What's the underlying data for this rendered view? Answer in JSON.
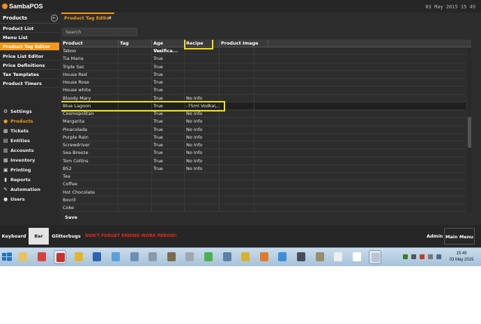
{
  "app": {
    "name": "SambaPOS",
    "clock": "03 May 2015 15 49"
  },
  "sidebar": {
    "header": "Products",
    "back_icon": "arrow-left-icon",
    "sub_items": [
      {
        "label": "Product List",
        "active": false
      },
      {
        "label": "Menu List",
        "active": false
      },
      {
        "label": "Product Tag Editor",
        "active": true
      },
      {
        "label": "Price List Editor",
        "active": false
      },
      {
        "label": "Price Definitions",
        "active": false
      },
      {
        "label": "Tax Templates",
        "active": false
      },
      {
        "label": "Product Timers",
        "active": false
      }
    ],
    "nav_items": [
      {
        "label": "Settings",
        "icon": "gear-icon",
        "glyph": "⚙",
        "active": false
      },
      {
        "label": "Products",
        "icon": "flame-icon",
        "glyph": "●",
        "active": true
      },
      {
        "label": "Tickets",
        "icon": "ticket-icon",
        "glyph": "▦",
        "active": false
      },
      {
        "label": "Entities",
        "icon": "entities-icon",
        "glyph": "▤",
        "active": false
      },
      {
        "label": "Accounts",
        "icon": "calculator-icon",
        "glyph": "▥",
        "active": false
      },
      {
        "label": "Inventory",
        "icon": "inventory-icon",
        "glyph": "▩",
        "active": false
      },
      {
        "label": "Printing",
        "icon": "printer-icon",
        "glyph": "▣",
        "active": false
      },
      {
        "label": "Reports",
        "icon": "chart-icon",
        "glyph": "▮",
        "active": false
      },
      {
        "label": "Automation",
        "icon": "wrench-icon",
        "glyph": "✎",
        "active": false
      },
      {
        "label": "Users",
        "icon": "user-icon",
        "glyph": "●",
        "active": false
      }
    ]
  },
  "tab": {
    "label": "Product Tag Editor",
    "close": "×"
  },
  "search": {
    "placeholder": "Search"
  },
  "grid": {
    "columns": [
      "Product",
      "Tag",
      "Age Verifica...",
      "Recipe",
      "Product Image"
    ],
    "rows": [
      [
        "Taboo",
        "",
        "True",
        "",
        ""
      ],
      [
        "Tia Maria",
        "",
        "True",
        "",
        ""
      ],
      [
        "Triple Sec",
        "",
        "True",
        "",
        ""
      ],
      [
        "House Red",
        "",
        "True",
        "",
        ""
      ],
      [
        "House Rose",
        "",
        "True",
        "",
        ""
      ],
      [
        "House white",
        "",
        "True",
        "",
        ""
      ],
      [
        "Bloody Mary",
        "",
        "True",
        "No Info",
        ""
      ],
      [
        "Blue Lagoon",
        "",
        "True",
        "-75ml Vodka\\...",
        ""
      ],
      [
        "Cosmopolitan",
        "",
        "True",
        "No Info",
        ""
      ],
      [
        "Margarita",
        "",
        "True",
        "No Info",
        ""
      ],
      [
        "Pinacolada",
        "",
        "True",
        "No Info",
        ""
      ],
      [
        "Purple Rain",
        "",
        "True",
        "No Info",
        ""
      ],
      [
        "Screwdriver",
        "",
        "True",
        "No Info",
        ""
      ],
      [
        "Sea Breeze",
        "",
        "True",
        "No Info",
        ""
      ],
      [
        "Tom Collins",
        "",
        "True",
        "No Info",
        ""
      ],
      [
        "B52",
        "",
        "True",
        "No Info",
        ""
      ],
      [
        "Tea",
        "",
        "",
        "",
        ""
      ],
      [
        "Coffee",
        "",
        "",
        "",
        ""
      ],
      [
        "Hot Chocolate",
        "",
        "",
        "",
        ""
      ],
      [
        "Bovril",
        "",
        "",
        "",
        ""
      ],
      [
        "Coke",
        "",
        "",
        "",
        ""
      ]
    ],
    "selected_row": 7
  },
  "save_label": "Save",
  "bottom": {
    "keyboard": "Keyboard",
    "bar": "Bar",
    "glitterbugs": "Glitterbugs",
    "message": "DON'T FORGET ENDING WORK PERIOD!",
    "admin": "Admin",
    "main_menu": "Main Menu"
  },
  "taskbar": {
    "time": "15:49",
    "date": "03 May 2015",
    "icons": [
      {
        "name": "file-explorer-icon",
        "color": "#e9c25a"
      },
      {
        "name": "itunes-icon",
        "color": "#d9413b"
      },
      {
        "name": "samba-icon",
        "color": "#c8332b"
      },
      {
        "name": "chrome-icon",
        "color": "#e5b52b"
      },
      {
        "name": "app-icon",
        "color": "#2a66b0"
      },
      {
        "name": "paint-icon",
        "color": "#5aa0d8"
      },
      {
        "name": "media-icon",
        "color": "#6c8fb5"
      },
      {
        "name": "disk-icon",
        "color": "#8b9aa8"
      },
      {
        "name": "tool-icon",
        "color": "#7a6b4a"
      },
      {
        "name": "printer-icon",
        "color": "#9fa8b2"
      },
      {
        "name": "database-icon",
        "color": "#4bb04e"
      },
      {
        "name": "calculator-icon",
        "color": "#5a7fa8"
      },
      {
        "name": "network-icon",
        "color": "#d7b32b"
      },
      {
        "name": "flame-icon",
        "color": "#e07a2b"
      },
      {
        "name": "internet-explorer-icon",
        "color": "#3b8fd8"
      },
      {
        "name": "shell-icon",
        "color": "#444e5a"
      },
      {
        "name": "key-icon",
        "color": "#9a8c6b"
      },
      {
        "name": "hand-icon",
        "color": "#eeeeee"
      },
      {
        "name": "pointer-icon",
        "color": "#ffffff"
      },
      {
        "name": "window-icon",
        "color": "#b9c4cf"
      }
    ]
  }
}
